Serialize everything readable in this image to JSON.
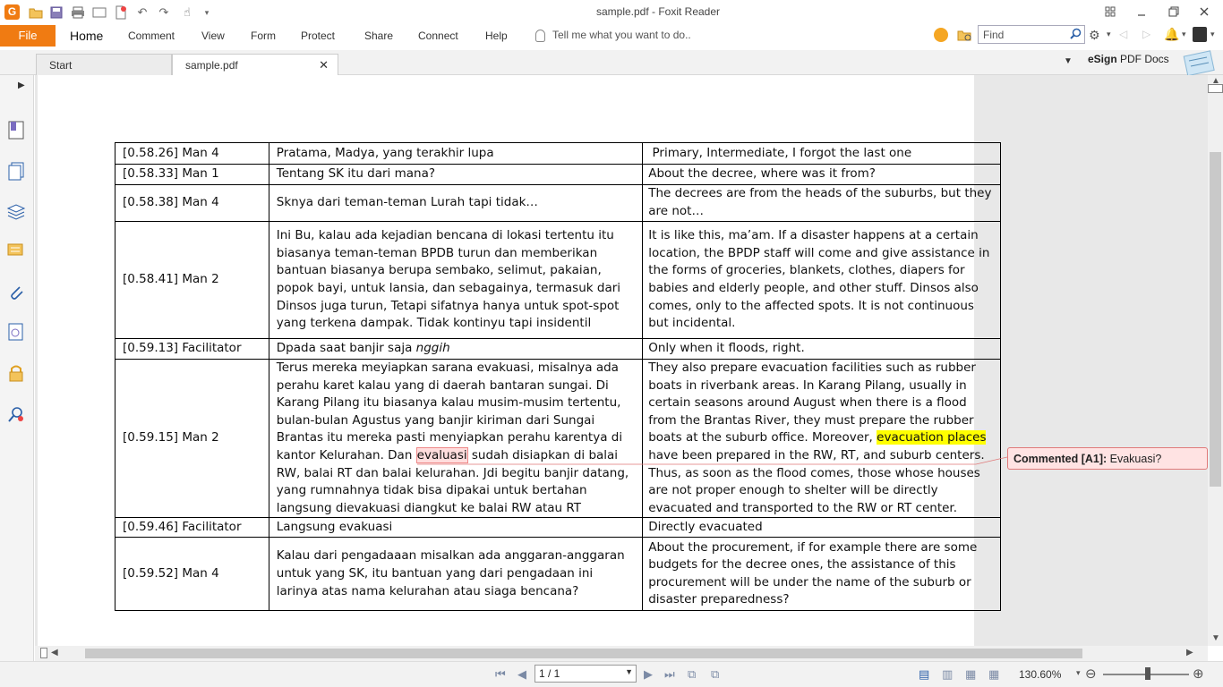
{
  "window": {
    "title": "sample.pdf - Foxit Reader",
    "app_logo": "G",
    "accent": "#f07b12"
  },
  "ribbon": {
    "file_label": "File",
    "tabs": [
      {
        "label": "Home",
        "active": true
      },
      {
        "label": "Comment"
      },
      {
        "label": "View"
      },
      {
        "label": "Form"
      },
      {
        "label": "Protect"
      },
      {
        "label": "Share"
      },
      {
        "label": "Connect"
      },
      {
        "label": "Help"
      }
    ],
    "tell_me_placeholder": "Tell me what you want to do..",
    "find_placeholder": "Find"
  },
  "doc_tabs": {
    "tabs": [
      {
        "label": "Start"
      },
      {
        "label": "sample.pdf",
        "active": true
      }
    ],
    "esign_bold": "eSign",
    "esign_rest": " PDF Docs"
  },
  "transcript": {
    "rows": [
      {
        "speaker": "[0.58.26] Man 4",
        "indonesian": "Pratama, Madya, yang terakhir lupa",
        "english": " Primary, Intermediate, I forgot the last one"
      },
      {
        "speaker": "[0.58.33] Man 1",
        "indonesian": "Tentang SK itu dari mana?",
        "english": "About the decree, where was it from?"
      },
      {
        "speaker": "[0.58.38] Man 4",
        "indonesian": "Sknya dari teman-teman Lurah tapi tidak…",
        "english": "The decrees are from the heads of the suburbs, but they are not…"
      },
      {
        "speaker": "[0.58.41] Man 2",
        "indonesian": "Ini Bu, kalau ada kejadian bencana di lokasi tertentu itu biasanya teman-teman BPDB turun dan memberikan bantuan biasanya berupa sembako, selimut, pakaian, popok bayi, untuk lansia, dan sebagainya, termasuk dari Dinsos juga turun, Tetapi sifatnya hanya untuk spot-spot yang terkena dampak. Tidak kontinyu tapi insidentil",
        "english": "It is like this, ma’am. If a disaster happens at a certain location, the BPDP staff will come and give assistance in the forms of groceries, blankets, clothes, diapers for babies and elderly people, and other stuff. Dinsos also comes, only to the affected spots. It is not continuous but incidental."
      },
      {
        "speaker": "[0.59.13] Facilitator",
        "indonesian": "Dpada saat banjir saja ",
        "indonesian_italic": "nggih",
        "english": "Only when it floods, right."
      },
      {
        "speaker": "[0.59.15] Man 2",
        "indonesian_a": "Terus mereka meyiapkan sarana evakuasi, misalnya ada perahu karet kalau yang di daerah bantaran sungai. Di Karang Pilang itu biasanya kalau musim-musim tertentu, bulan-bulan Agustus yang banjir kiriman dari Sungai Brantas itu mereka pasti menyiapkan perahu karentya di kantor Kelurahan. Dan ",
        "indonesian_mark": "evaluasi",
        "indonesian_b": " sudah disiapkan di balai RW, balai RT dan balai kelurahan. Jdi begitu banjir datang, yang rumnahnya tidak bisa dipakai untuk bertahan langsung dievakuasi diangkut ke balai RW atau RT",
        "english_a": "They also prepare evacuation facilities such as rubber boats in riverbank areas. In Karang Pilang, usually in certain seasons around August when there is a flood from the Brantas River, they must prepare the rubber boats at the suburb office. Moreover, ",
        "english_highlight": "evacuation places",
        "english_b": " have been prepared in the RW, RT, and suburb centers. Thus, as soon as the flood comes, those whose houses are not proper enough to shelter will be directly evacuated and transported to the RW or RT center."
      },
      {
        "speaker": "[0.59.46] Facilitator",
        "indonesian": "Langsung evakuasi",
        "english": "Directly evacuated"
      },
      {
        "speaker": "[0.59.52] Man 4",
        "indonesian": "Kalau dari pengadaaan misalkan ada anggaran-anggaran untuk yang SK, itu bantuan yang dari pengadaan ini larinya atas nama kelurahan atau siaga bencana?",
        "english": "About the procurement, if for example there are some budgets for the decree ones, the assistance of this procurement will be under the name of the suburb or disaster preparedness?"
      }
    ]
  },
  "comment": {
    "label": "Commented [A1]:",
    "text": " Evakuasi?",
    "color": "#e07a7a"
  },
  "statusbar": {
    "page_value": "1 / 1",
    "zoom": "130.60%"
  },
  "icons": [
    "open-icon",
    "save-icon",
    "print-icon",
    "undo-icon",
    "redo-icon",
    "hand-icon",
    "bookmark-icon",
    "pages-icon",
    "layers-icon",
    "comments-icon",
    "attachment-icon",
    "signature-icon",
    "lock-icon",
    "magnifier-icon"
  ]
}
